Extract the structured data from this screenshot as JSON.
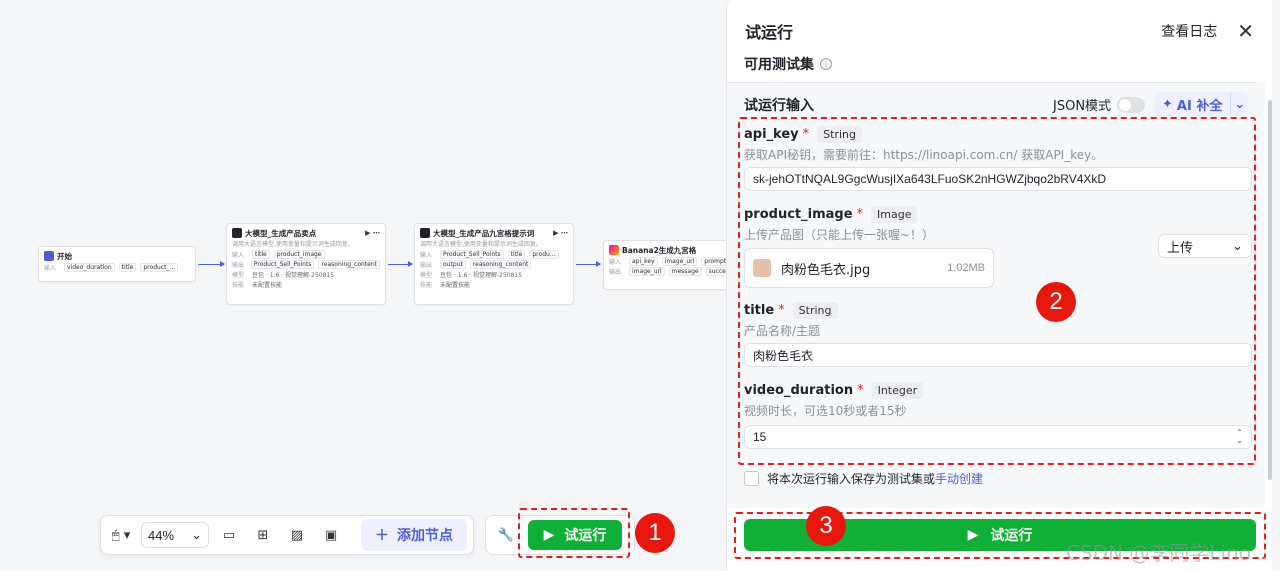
{
  "canvas": {
    "nodes": [
      {
        "id": "start",
        "title": "开始",
        "desc": "",
        "rows": [
          {
            "label": "输入",
            "tags": [
              "video_duration",
              "title",
              "product_..."
            ]
          }
        ]
      },
      {
        "id": "llm1",
        "title": "大模型_生成产品卖点",
        "desc": "调用大语言模型,使用变量和提示词生成回复。",
        "rows": [
          {
            "label": "输入",
            "tags": [
              "title",
              "product_image"
            ]
          },
          {
            "label": "输出",
            "tags": [
              "Product_Sell_Points",
              "reasoning_content"
            ]
          },
          {
            "label": "模型",
            "tags": [
              "豆包 · 1.6 · 视觉理解-250815"
            ]
          },
          {
            "label": "技能",
            "tags": [
              "未配置技能"
            ]
          }
        ]
      },
      {
        "id": "llm2",
        "title": "大模型_生成产品九宫格提示词",
        "desc": "调用大语言模型,使用变量和提示词生成回复。",
        "rows": [
          {
            "label": "输入",
            "tags": [
              "Product_Sell_Points",
              "title",
              "produ..."
            ]
          },
          {
            "label": "输出",
            "tags": [
              "output",
              "reasoning_content"
            ]
          },
          {
            "label": "模型",
            "tags": [
              "豆包 · 1.6 · 视觉理解-250815"
            ]
          },
          {
            "label": "技能",
            "tags": [
              "未配置技能"
            ]
          }
        ]
      },
      {
        "id": "banana",
        "title": "Banana2生成九宫格",
        "desc": "",
        "rows": [
          {
            "label": "输入",
            "tags": [
              "api_key",
              "image_url",
              "prompt"
            ]
          },
          {
            "label": "输出",
            "tags": [
              "image_url",
              "message",
              "success"
            ]
          }
        ]
      }
    ]
  },
  "toolbar": {
    "zoom": "44%",
    "add_node": "添加节点",
    "run": "试运行"
  },
  "badges": [
    "1",
    "2",
    "3"
  ],
  "panel": {
    "title": "试运行",
    "log": "查看日志",
    "testset_label": "可用测试集",
    "input_section": "试运行输入",
    "json_mode": "JSON模式",
    "ai_fill": "AI 补全",
    "fields": [
      {
        "name": "api_key",
        "type": "String",
        "desc": "获取API秘钥，需要前往：https://linoapi.com.cn/ 获取API_key。",
        "value": "sk-jehOTtNQAL9GgcWusjIXa643LFuoSK2nHGWZjbqo2bRV4XkD"
      },
      {
        "name": "product_image",
        "type": "Image",
        "desc": "上传产品图（只能上传一张喔~！）",
        "select": "上传",
        "file_name": "肉粉色毛衣.jpg",
        "file_size": "1.02MB"
      },
      {
        "name": "title",
        "type": "String",
        "desc": "产品名称/主题",
        "value": "肉粉色毛衣"
      },
      {
        "name": "video_duration",
        "type": "Integer",
        "desc": "视频时长，可选10秒或者15秒",
        "value": "15"
      }
    ],
    "save_text": "将本次运行输入保存为测试集或",
    "save_link": "手动创建",
    "run": "试运行"
  },
  "watermark": "CSDN @李同学Lino",
  "colors": {
    "accent": "#4e5dd6",
    "run_green": "#10b038",
    "annotation_red": "#e02020"
  }
}
